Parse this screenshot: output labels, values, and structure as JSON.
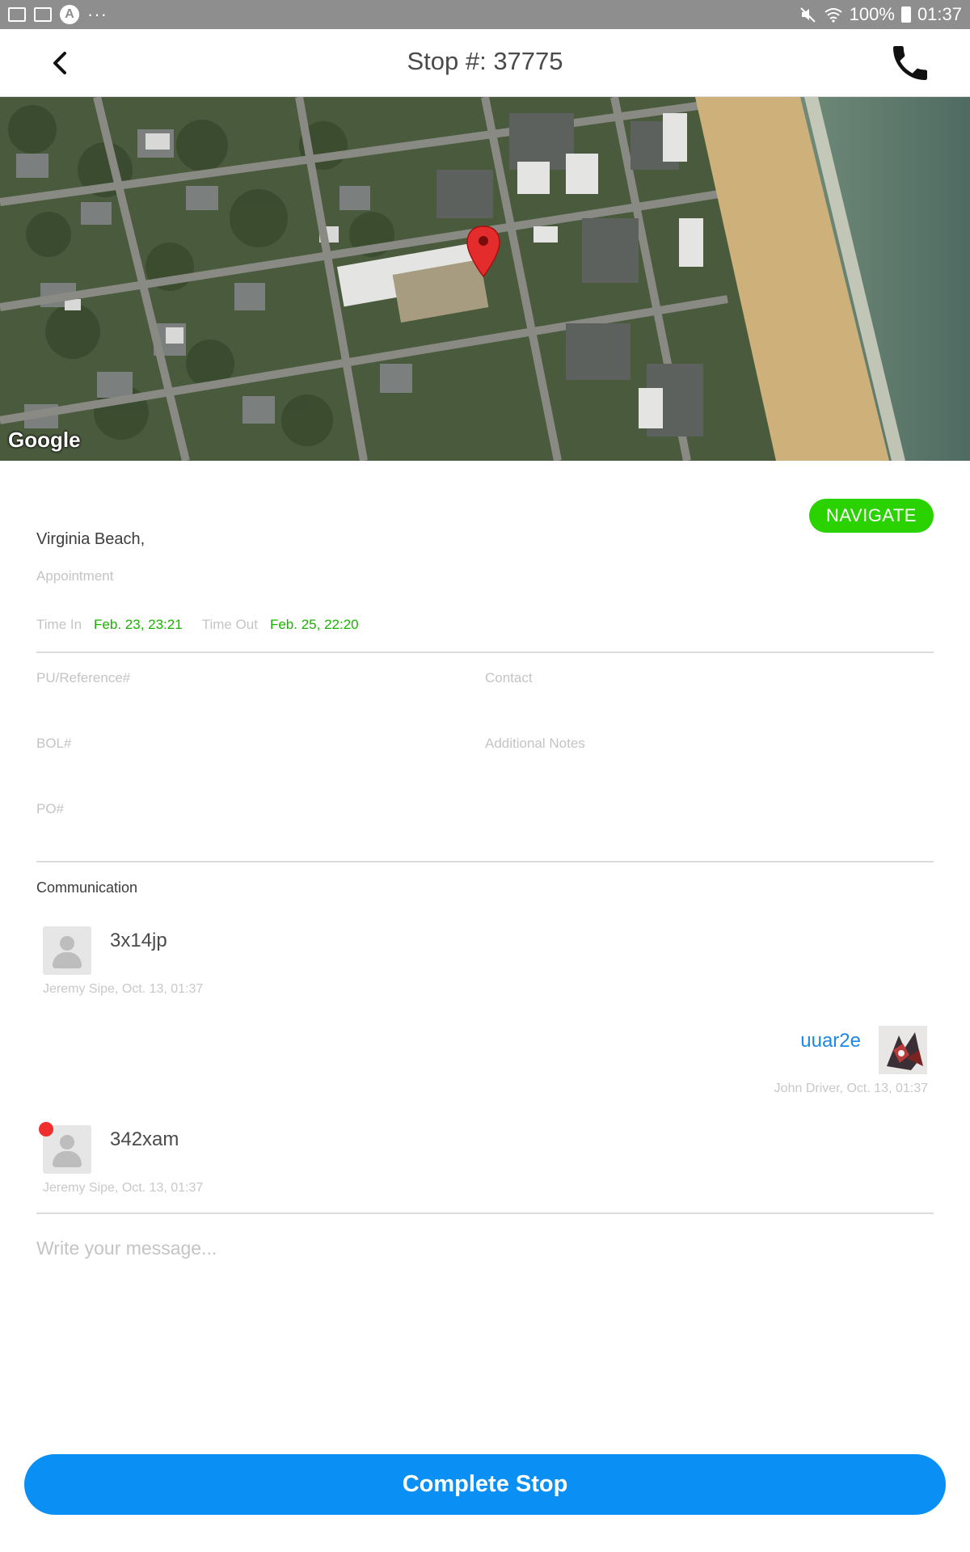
{
  "status_bar": {
    "battery": "100%",
    "time": "01:37",
    "dots": "···",
    "icons": [
      "image-icon",
      "mail-icon",
      "app-icon",
      "mute-icon",
      "wifi-icon",
      "battery-icon"
    ]
  },
  "header": {
    "title": "Stop #: 37775",
    "back_icon": "chevron-left-icon",
    "call_icon": "phone-icon"
  },
  "map": {
    "attribution": "Google",
    "marker_icon": "map-pin-icon"
  },
  "stop": {
    "navigate_label": "NAVIGATE",
    "address": "Virginia Beach,",
    "appointment_label": "Appointment",
    "time_in_label": "Time In",
    "time_in_value": "Feb. 23, 23:21",
    "time_out_label": "Time Out",
    "time_out_value": "Feb. 25, 22:20"
  },
  "fields": {
    "pu_reference_label": "PU/Reference#",
    "contact_label": "Contact",
    "bol_label": "BOL#",
    "additional_notes_label": "Additional Notes",
    "po_label": "PO#"
  },
  "communication": {
    "title": "Communication",
    "messages": [
      {
        "text": "3x14jp",
        "meta": "Jeremy Sipe, Oct. 13, 01:37",
        "side": "left",
        "unread": false
      },
      {
        "text": "uuar2e",
        "meta": "John Driver, Oct. 13, 01:37",
        "side": "right",
        "unread": false
      },
      {
        "text": "342xam",
        "meta": "Jeremy Sipe, Oct. 13, 01:37",
        "side": "left",
        "unread": true
      }
    ],
    "input_placeholder": "Write your message..."
  },
  "actions": {
    "complete_label": "Complete Stop"
  },
  "colors": {
    "accent_blue": "#0a90f5",
    "navigate_green": "#2ad200",
    "time_green": "#19b300",
    "unread_red": "#f02e2e"
  }
}
